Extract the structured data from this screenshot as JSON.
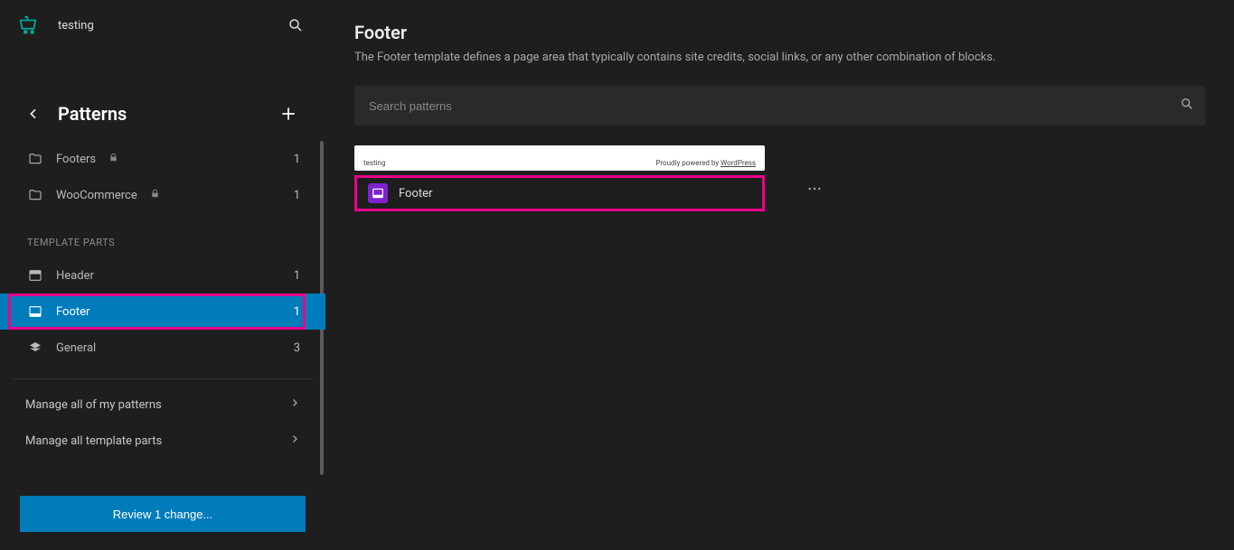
{
  "top": {
    "site_name": "testing"
  },
  "nav": {
    "title": "Patterns"
  },
  "categories": [
    {
      "label": "Footers",
      "count": "1",
      "locked": true
    },
    {
      "label": "WooCommerce",
      "count": "1",
      "locked": true
    }
  ],
  "template_parts_heading": "TEMPLATE PARTS",
  "template_parts": [
    {
      "label": "Header",
      "count": "1",
      "selected": false
    },
    {
      "label": "Footer",
      "count": "1",
      "selected": true
    },
    {
      "label": "General",
      "count": "3",
      "selected": false
    }
  ],
  "manage_links": {
    "patterns": "Manage all of my patterns",
    "template_parts": "Manage all template parts"
  },
  "review_button": "Review 1 change...",
  "main": {
    "heading": "Footer",
    "desc": "The Footer template defines a page area that typically contains site credits, social links, or any other combination of blocks.",
    "search_placeholder": "Search patterns",
    "preview": {
      "left": "testing",
      "right_prefix": "Proudly powered by ",
      "right_link": "WordPress"
    },
    "card_title": "Footer"
  }
}
